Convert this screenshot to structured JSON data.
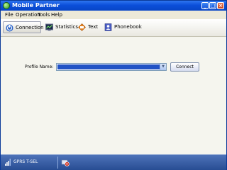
{
  "window": {
    "title": "Mobile Partner"
  },
  "menu": {
    "items": [
      "File",
      "Operation",
      "Tools",
      "Help"
    ]
  },
  "window_buttons": {
    "minimize": "_",
    "maximize": "□",
    "close": "×"
  },
  "tabs": [
    {
      "label": "Connection",
      "icon": "connection-icon",
      "active": true
    },
    {
      "label": "Statistics",
      "icon": "statistics-icon",
      "active": false
    },
    {
      "label": "Text",
      "icon": "text-message-icon",
      "active": false
    },
    {
      "label": "Phonebook",
      "icon": "phonebook-icon",
      "active": false
    }
  ],
  "profile": {
    "label": "Profile Name:",
    "value": ""
  },
  "connect_button": {
    "label": "Connect"
  },
  "status": {
    "network": "GPRS T-SEL"
  },
  "colors": {
    "titlebar": "#0b4fd9",
    "selection": "#2152c5",
    "statusbar": "#3a5fa5"
  }
}
